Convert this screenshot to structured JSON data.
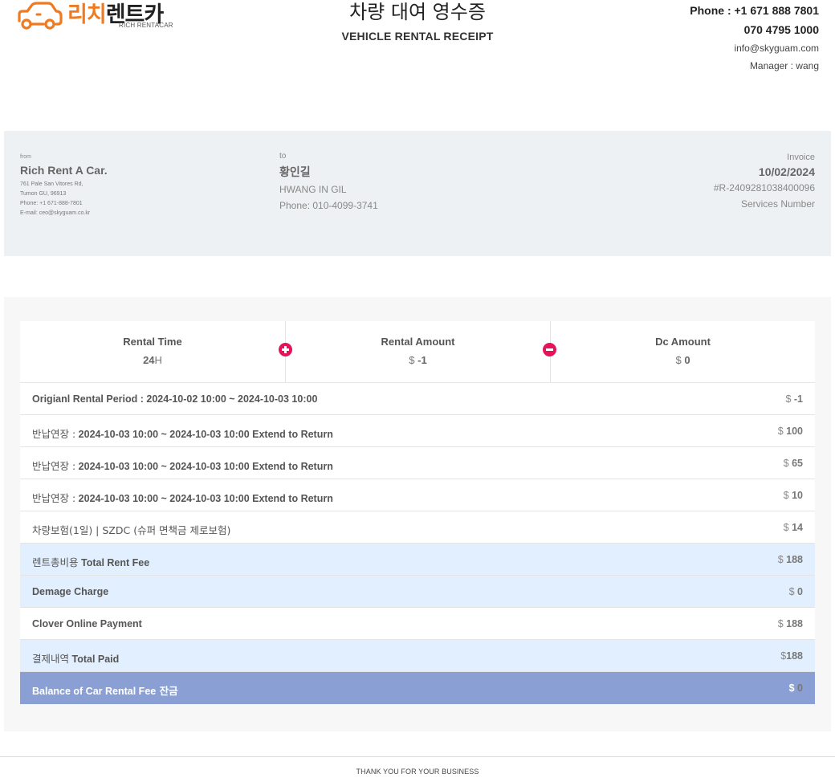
{
  "brand": {
    "logo_ko_1": "리치",
    "logo_ko_2": "렌트카",
    "logo_en": "RICH RENTACAR",
    "colors": {
      "orange": "#f07a1f",
      "pink": "#e8125c",
      "highlight_blue": "#e2efff",
      "balance_blue": "#8aa0d4"
    }
  },
  "title": {
    "ko": "차량 대여 영수증",
    "en": "VEHICLE RENTAL RECEIPT"
  },
  "contact": {
    "phone": "Phone : +1 671 888 7801",
    "phone2": "070 4795 1000",
    "email": "info@skyguam.com",
    "manager": "Manager : wang"
  },
  "from": {
    "label": "from",
    "name": "Rich Rent A Car.",
    "address1": "761 Pale San Vitores Rd,",
    "address2": "Tumon GU, 96913",
    "phone": "Phone: +1 671-888-7801",
    "email": "E-mail: ceo@skyguam.co.kr"
  },
  "to": {
    "label": "to",
    "name_ko": "황인길",
    "name_en": "HWANG IN GIL",
    "phone": "Phone: 010-4099-3741"
  },
  "invoice": {
    "label": "Invoice",
    "date": "10/02/2024",
    "number": "#R-2409281038400096",
    "services_label": "Services Number"
  },
  "summary": {
    "rental_time": {
      "label": "Rental Time",
      "value": "24",
      "unit": "H"
    },
    "rental_amount": {
      "label": "Rental Amount",
      "currency": "$",
      "value": "-1"
    },
    "dc_amount": {
      "label": "Dc Amount",
      "currency": "$",
      "value": "0"
    },
    "plus_icon": "plus-circle-icon",
    "minus_icon": "minus-circle-icon"
  },
  "rows": [
    {
      "label": "Origianl Rental Period : 2024-10-02 10:00 ~ 2024-10-03 10:00",
      "currency": "$",
      "amount": "-1"
    },
    {
      "label_ko": "반납연장 :",
      "label": " 2024-10-03 10:00 ~ 2024-10-03 10:00 Extend to Return",
      "currency": "$",
      "amount": "100"
    },
    {
      "label_ko": "반납연장 :",
      "label": " 2024-10-03 10:00 ~ 2024-10-03 10:00 Extend to Return",
      "currency": "$",
      "amount": "65"
    },
    {
      "label_ko": "반납연장 :",
      "label": " 2024-10-03 10:00 ~ 2024-10-03 10:00 Extend to Return",
      "currency": "$",
      "amount": "10"
    },
    {
      "label_ko": "차량보험(1일) | SZDC (슈퍼 면책금 제로보험)",
      "label": "",
      "currency": "$",
      "amount": "14"
    },
    {
      "label_ko": "렌트총비용",
      "label": " Total Rent Fee",
      "currency": "$",
      "amount": "188"
    },
    {
      "label": "Demage Charge",
      "currency": "$",
      "amount": "0"
    },
    {
      "label": "Clover Online Payment",
      "currency": "$",
      "amount": "188"
    },
    {
      "label_ko": "결제내역",
      "label": " Total Paid",
      "currency": "$",
      "amount": "188"
    },
    {
      "label": "Balance of Car Rental Fee",
      "label_ko_suffix": " 잔금",
      "currency": "$",
      "amount": "0"
    }
  ],
  "footer": "THANK YOU FOR YOUR BUSINESS"
}
